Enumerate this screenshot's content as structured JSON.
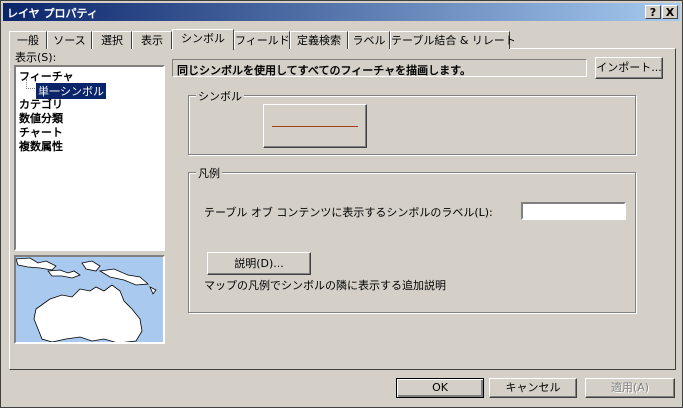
{
  "window": {
    "title": "レイヤ プロパティ",
    "help_glyph": "?",
    "close_glyph": "X"
  },
  "tabs": [
    {
      "label": "一般"
    },
    {
      "label": "ソース"
    },
    {
      "label": "選択"
    },
    {
      "label": "表示"
    },
    {
      "label": "シンボル",
      "active": true
    },
    {
      "label": "フィールド"
    },
    {
      "label": "定義検索"
    },
    {
      "label": "ラベル"
    },
    {
      "label": "テーブル結合 & リレート"
    }
  ],
  "show": {
    "label": "表示(S):",
    "items": {
      "feature": "フィーチャ",
      "single_symbol": "単一シンボル",
      "category": "カテゴリ",
      "quantity": "数値分類",
      "chart": "チャート",
      "multi_attr": "複数属性"
    }
  },
  "description": "同じシンボルを使用してすべてのフィーチャを描画します。",
  "import_button": "インポート...",
  "symbol_group": {
    "title": "シンボル",
    "line_color": "#a0401a"
  },
  "legend_group": {
    "title": "凡例",
    "label_text": "テーブル オブ コンテンツに表示するシンボルのラベル(L):",
    "label_value": "",
    "desc_button": "説明(D)...",
    "note": "マップの凡例でシンボルの隣に表示する追加説明"
  },
  "footer": {
    "ok": "OK",
    "cancel": "キャンセル",
    "apply": "適用(A)"
  },
  "colors": {
    "title_bar_start": "#0a246a",
    "title_bar_end": "#a6caf0",
    "selection": "#0a246a",
    "water": "#a9c9ef",
    "land": "#ffffff"
  }
}
